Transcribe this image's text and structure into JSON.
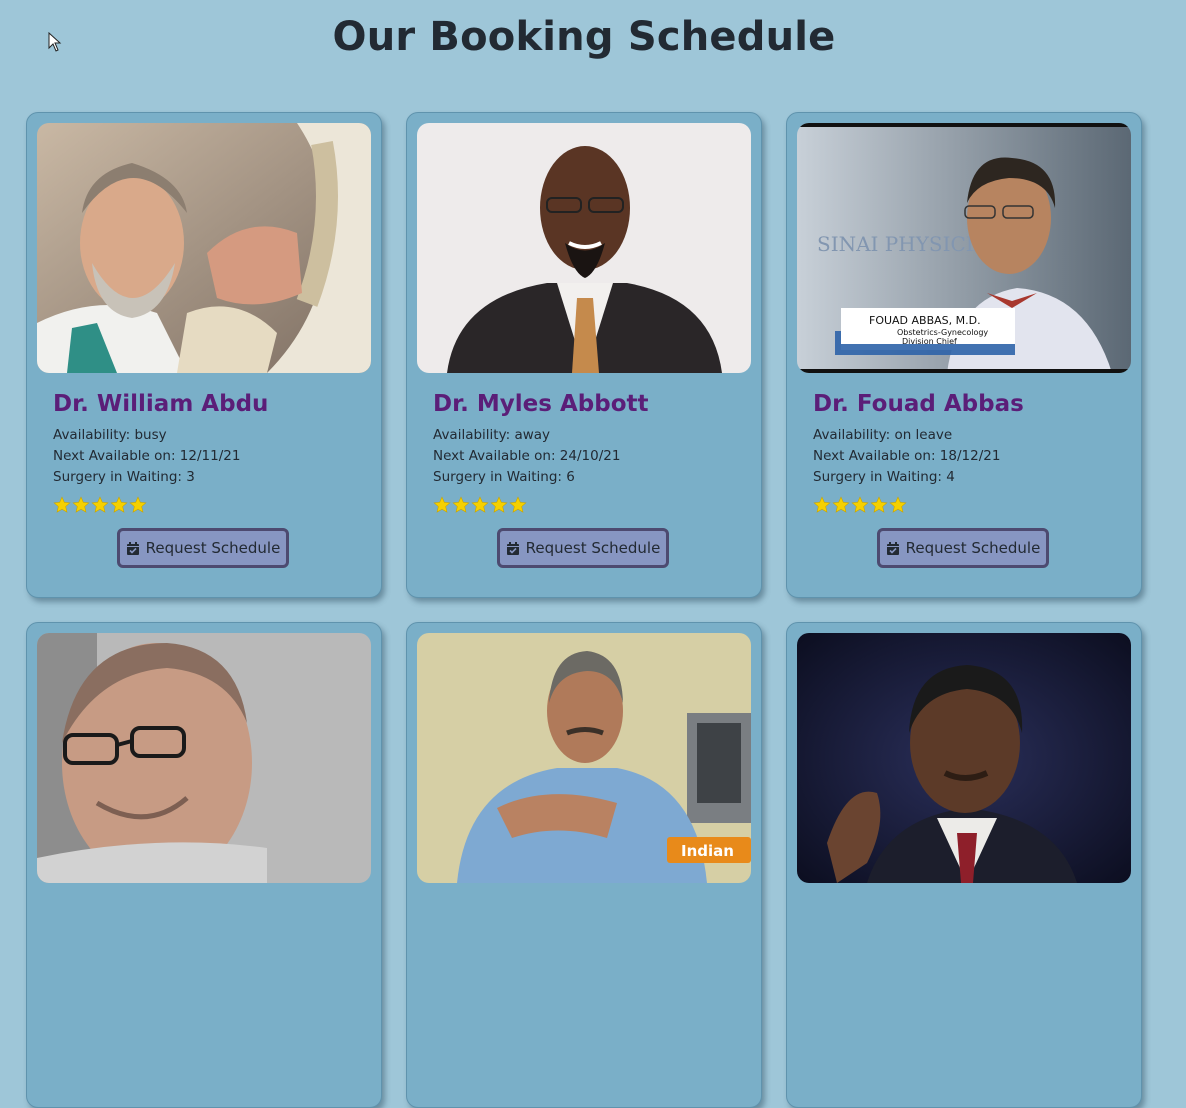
{
  "page": {
    "title": "Our Booking Schedule"
  },
  "theme": {
    "background": "#9ec6d8",
    "card": "#7aafc8",
    "name_color": "#5b1e78",
    "button_bg": "#8796c2",
    "button_border": "#4d4a70",
    "star_color": "#f5d000"
  },
  "doctors": [
    {
      "name": "Dr. William Abdu",
      "availability": "Availability: busy",
      "next_available": "Next Available on: 12/11/21",
      "surgery_waiting": "Surgery in Waiting: 3",
      "rating": 5,
      "button_label": "Request Schedule",
      "button_icon": "calendar-check-icon"
    },
    {
      "name": "Dr. Myles Abbott",
      "availability": "Availability: away",
      "next_available": "Next Available on: 24/10/21",
      "surgery_waiting": "Surgery in Waiting: 6",
      "rating": 5,
      "button_label": "Request Schedule",
      "button_icon": "calendar-check-icon"
    },
    {
      "name": "Dr. Fouad Abbas",
      "availability": "Availability: on leave",
      "next_available": "Next Available on: 18/12/21",
      "surgery_waiting": "Surgery in Waiting: 4",
      "rating": 5,
      "button_label": "Request Schedule",
      "button_icon": "calendar-check-icon"
    }
  ],
  "photo_captions": {
    "fouad_banner": "SINAI PHYSICIA",
    "fouad_name_plate": "FOUAD ABBAS, M.D.",
    "fouad_title_1": "Obstetrics-Gynecology",
    "fouad_title_2": "Division Chief",
    "indian_logo": "Indian"
  }
}
